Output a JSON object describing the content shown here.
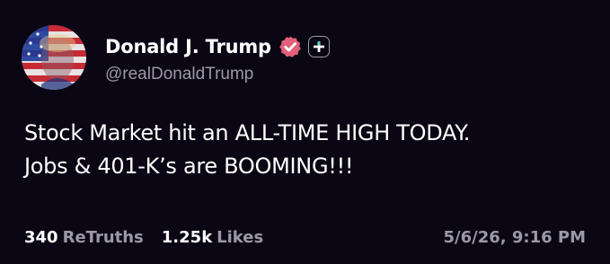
{
  "author": {
    "display_name": "Donald J. Trump",
    "handle": "@realDonaldTrump",
    "avatar_icon": "flag-portrait-avatar",
    "verified_icon": "verified-badge-icon",
    "follow_icon": "plus-icon"
  },
  "post": {
    "lines": [
      "Stock Market hit an ALL-TIME HIGH TODAY.",
      "Jobs & 401-K’s are BOOMING!!!"
    ]
  },
  "stats": {
    "retruths_count": "340",
    "retruths_label": "ReTruths",
    "likes_count": "1.25k",
    "likes_label": "Likes"
  },
  "timestamp": "5/6/26, 9:16 PM",
  "colors": {
    "background": "#0a0614",
    "text": "#ffffff",
    "muted": "#9b98a8",
    "verified_badge": "#e3607a"
  }
}
